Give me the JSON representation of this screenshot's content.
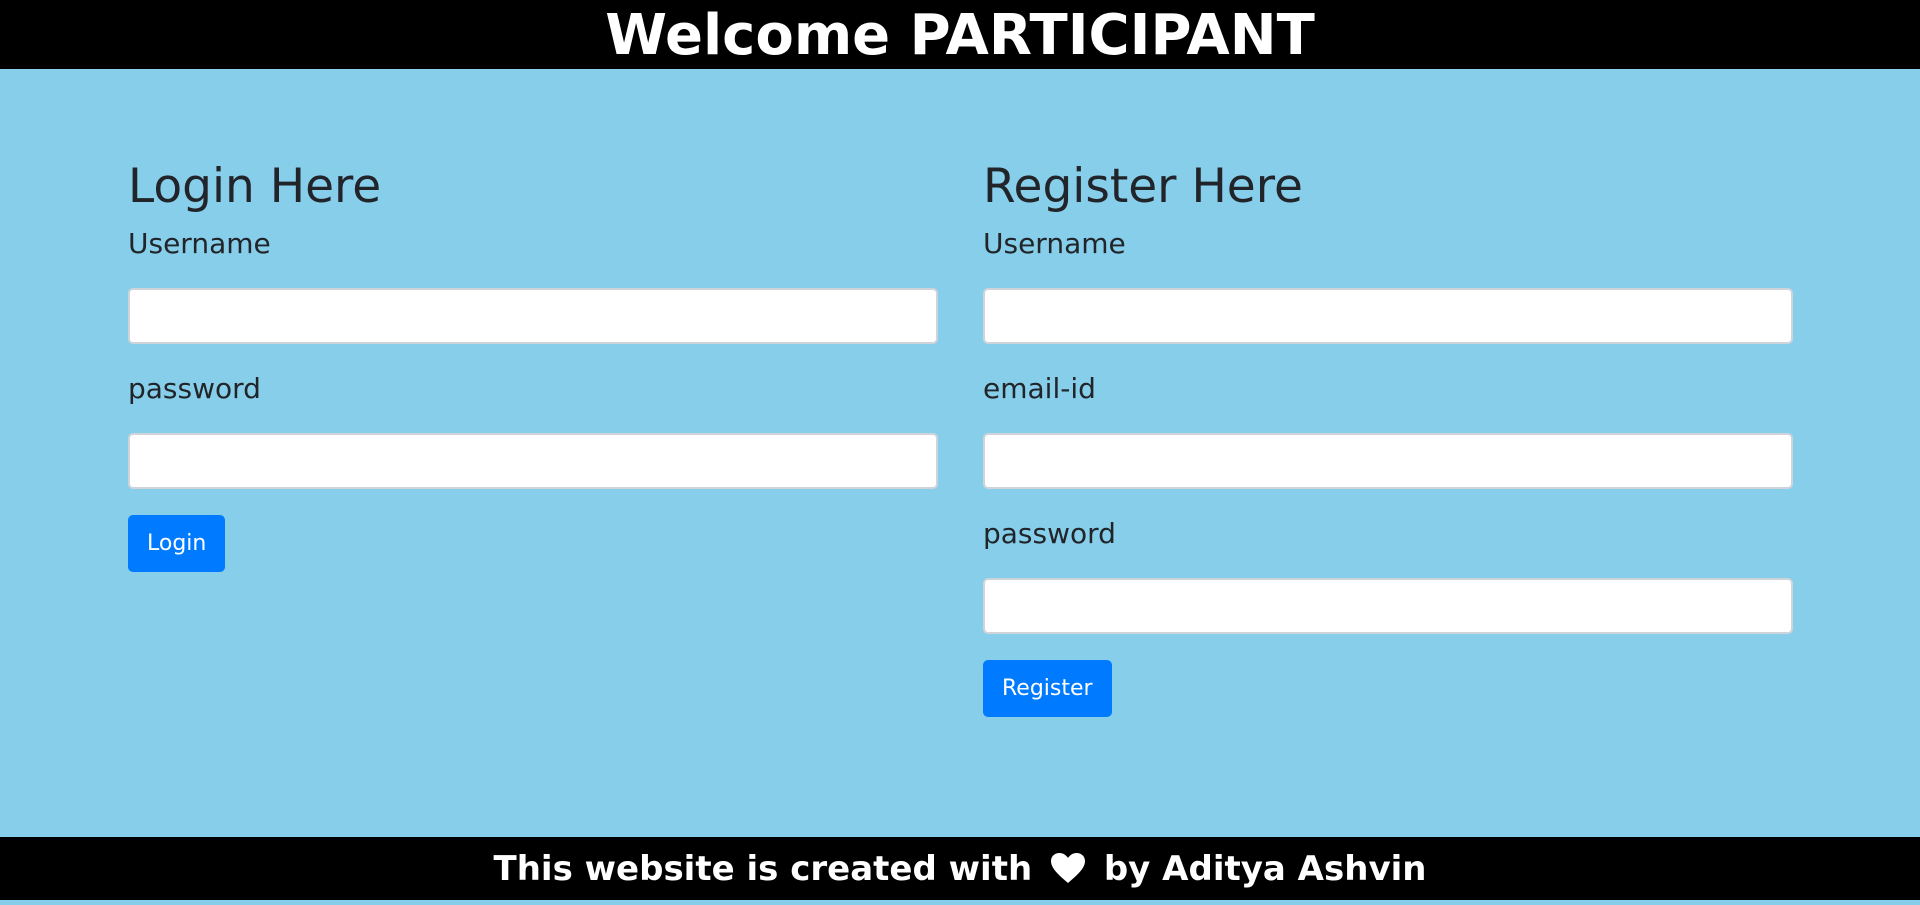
{
  "header": {
    "title": "Welcome PARTICIPANT"
  },
  "login": {
    "heading": "Login Here",
    "username_label": "Username",
    "username_value": "",
    "password_label": "password",
    "password_value": "",
    "button_label": "Login"
  },
  "register": {
    "heading": "Register Here",
    "username_label": "Username",
    "username_value": "",
    "email_label": "email-id",
    "email_value": "",
    "password_label": "password",
    "password_value": "",
    "button_label": "Register"
  },
  "footer": {
    "text_before": "This website is created with",
    "heart_icon": "heart-icon",
    "text_after": "by Aditya Ashvin"
  },
  "colors": {
    "background": "#87ceeb",
    "bar": "#000000",
    "button": "#007bff"
  }
}
